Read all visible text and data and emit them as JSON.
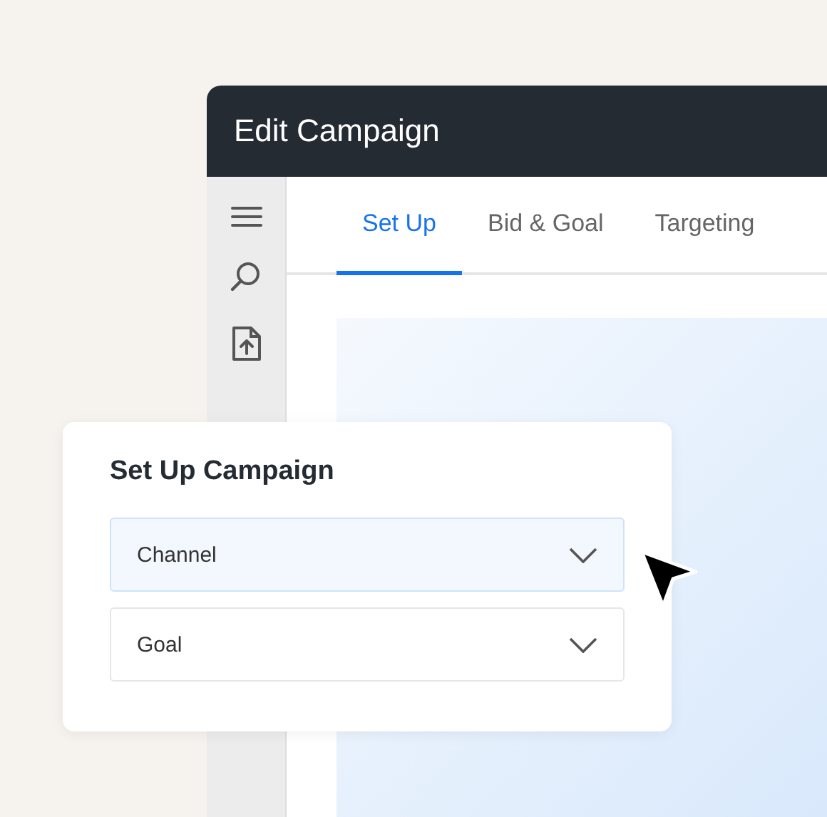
{
  "window": {
    "title": "Edit Campaign"
  },
  "tabs": [
    {
      "label": "Set Up",
      "selected": true
    },
    {
      "label": "Bid & Goal",
      "selected": false
    },
    {
      "label": "Targeting",
      "selected": false
    }
  ],
  "card": {
    "title": "Set Up Campaign",
    "fields": [
      {
        "label": "Channel",
        "selected": true
      },
      {
        "label": "Goal",
        "selected": false
      }
    ]
  }
}
